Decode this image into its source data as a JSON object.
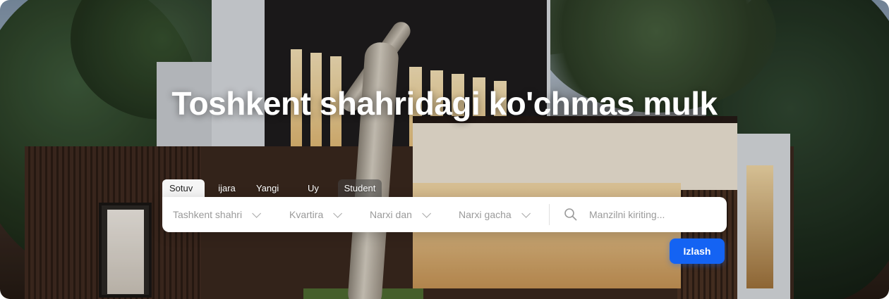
{
  "hero": {
    "title": "Toshkent shahridagi ko'chmas mulk"
  },
  "tabs": [
    {
      "label": "Sotuv",
      "active": true
    },
    {
      "label": "ijara",
      "active": false
    },
    {
      "label": "Yangi",
      "active": false
    },
    {
      "label": "Uy",
      "active": false
    },
    {
      "label": "Student",
      "active": false
    }
  ],
  "filters": {
    "city": {
      "value": "Tashkent shahri",
      "icon": "chevron-down-icon"
    },
    "type": {
      "value": "Kvartira",
      "icon": "chevron-down-icon"
    },
    "price_from": {
      "value": "Narxi dan",
      "icon": "chevron-down-icon"
    },
    "price_to": {
      "value": "Narxi gacha",
      "icon": "chevron-down-icon"
    }
  },
  "search": {
    "placeholder": "Manzilni kiriting...",
    "value": "",
    "icon": "search-icon"
  },
  "submit": {
    "label": "Izlash"
  },
  "colors": {
    "accent": "#1463f3",
    "title": "#ffffff",
    "active_tab_bg": "#f5f5f5",
    "placeholder": "#9a9a9a"
  }
}
